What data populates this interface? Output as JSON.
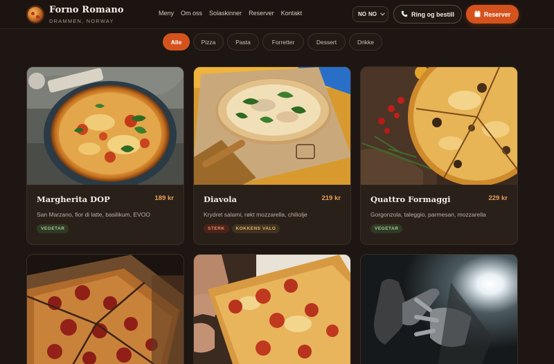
{
  "brand": {
    "name": "Forno Romano",
    "location": "DRAMMEN, NORWAY",
    "logo_icon": "pizza-logo-icon"
  },
  "nav": {
    "items": [
      "Meny",
      "Om oss",
      "Solaskinner",
      "Reserver",
      "Kontakt"
    ]
  },
  "language": {
    "flag_label": "NO",
    "code": "NO",
    "icon": "chevron-down-icon"
  },
  "actions": {
    "call_label": "Ring og bestill",
    "call_icon": "phone-icon",
    "reserve_label": "Reserver",
    "reserve_icon": "calendar-icon"
  },
  "filters": {
    "items": [
      "Alle",
      "Pizza",
      "Pasta",
      "Forretter",
      "Dessert",
      "Drikke"
    ],
    "active": "Alle"
  },
  "colors": {
    "accent": "#d4531c",
    "background": "#1d1612",
    "card": "#2a201a",
    "price": "#e8a05a"
  },
  "menu_items": [
    {
      "title": "Margherita DOP",
      "price": "189 kr",
      "description": "San Marzano, fior di latte, basilikum, EVOO",
      "tags": [
        "VEGETAR"
      ]
    },
    {
      "title": "Diavola",
      "price": "219 kr",
      "description": "Krydret salami, røkt mozzarella, chiliolje",
      "tags": [
        "STERK",
        "KOKKENS VALG"
      ]
    },
    {
      "title": "Quattro Formaggi",
      "price": "229 kr",
      "description": "Gorgonzola, taleggio, parmesan, mozzarella",
      "tags": [
        "VEGETAR"
      ]
    }
  ]
}
